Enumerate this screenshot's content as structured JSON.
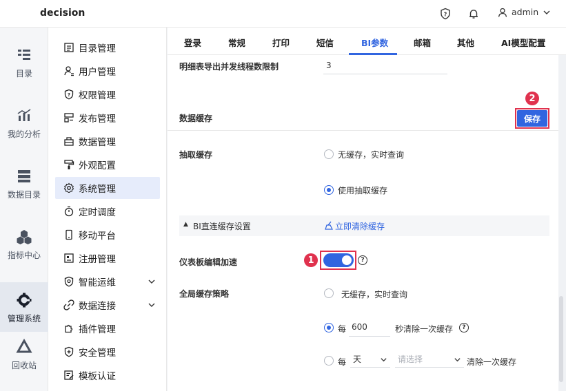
{
  "app": {
    "title": "decision"
  },
  "header": {
    "user": "admin"
  },
  "rail": [
    {
      "label": "目录",
      "icon": "catalog-icon"
    },
    {
      "label": "我的分析",
      "icon": "analysis-chart-icon"
    },
    {
      "label": "数据目录",
      "icon": "data-catalog-icon"
    },
    {
      "label": "指标中心",
      "icon": "metrics-hex-icon"
    },
    {
      "label": "管理系统",
      "icon": "gear-icon"
    },
    {
      "label": "回收站",
      "icon": "recycle-icon"
    }
  ],
  "submenu": [
    {
      "label": "目录管理",
      "icon": "list-icon"
    },
    {
      "label": "用户管理",
      "icon": "user-icon"
    },
    {
      "label": "权限管理",
      "icon": "shield-icon"
    },
    {
      "label": "发布管理",
      "icon": "publish-icon"
    },
    {
      "label": "数据管理",
      "icon": "database-icon"
    },
    {
      "label": "外观配置",
      "icon": "paint-icon"
    },
    {
      "label": "系统管理",
      "icon": "gear-icon"
    },
    {
      "label": "定时调度",
      "icon": "timer-icon"
    },
    {
      "label": "移动平台",
      "icon": "mobile-icon"
    },
    {
      "label": "注册管理",
      "icon": "register-icon"
    },
    {
      "label": "智能运维",
      "icon": "ops-icon"
    },
    {
      "label": "数据连接",
      "icon": "link-icon"
    },
    {
      "label": "插件管理",
      "icon": "plugin-icon"
    },
    {
      "label": "安全管理",
      "icon": "security-icon"
    },
    {
      "label": "模板认证",
      "icon": "template-cert-icon"
    }
  ],
  "tabs": [
    "登录",
    "常规",
    "打印",
    "短信",
    "BI参数",
    "邮箱",
    "其他",
    "AI模型配置"
  ],
  "active_tab": "BI参数",
  "detail_export": {
    "label": "明细表导出并发线程数限制",
    "value": "3"
  },
  "data_cache": {
    "title": "数据缓存",
    "save_label": "保存",
    "step_save": "2",
    "extract_label": "抽取缓存",
    "extract_options": [
      "无缓存，实时查询",
      "使用抽取缓存"
    ],
    "direct_section": "BI直连缓存设置",
    "clear_now": "立即清除缓存",
    "dashboard_label": "仪表板编辑加速",
    "step_toggle": "1",
    "dashboard_enabled": true,
    "global_label": "全局缓存策略",
    "global_opt1": "无缓存，实时查询",
    "every_label": "每",
    "seconds_value": "600",
    "seconds_suffix": "秒清除一次缓存",
    "day_value": "天",
    "select_placeholder": "请选择",
    "day_suffix": "清除一次缓存"
  },
  "colors": {
    "accent": "#3165e0",
    "highlight": "#e0324e"
  }
}
